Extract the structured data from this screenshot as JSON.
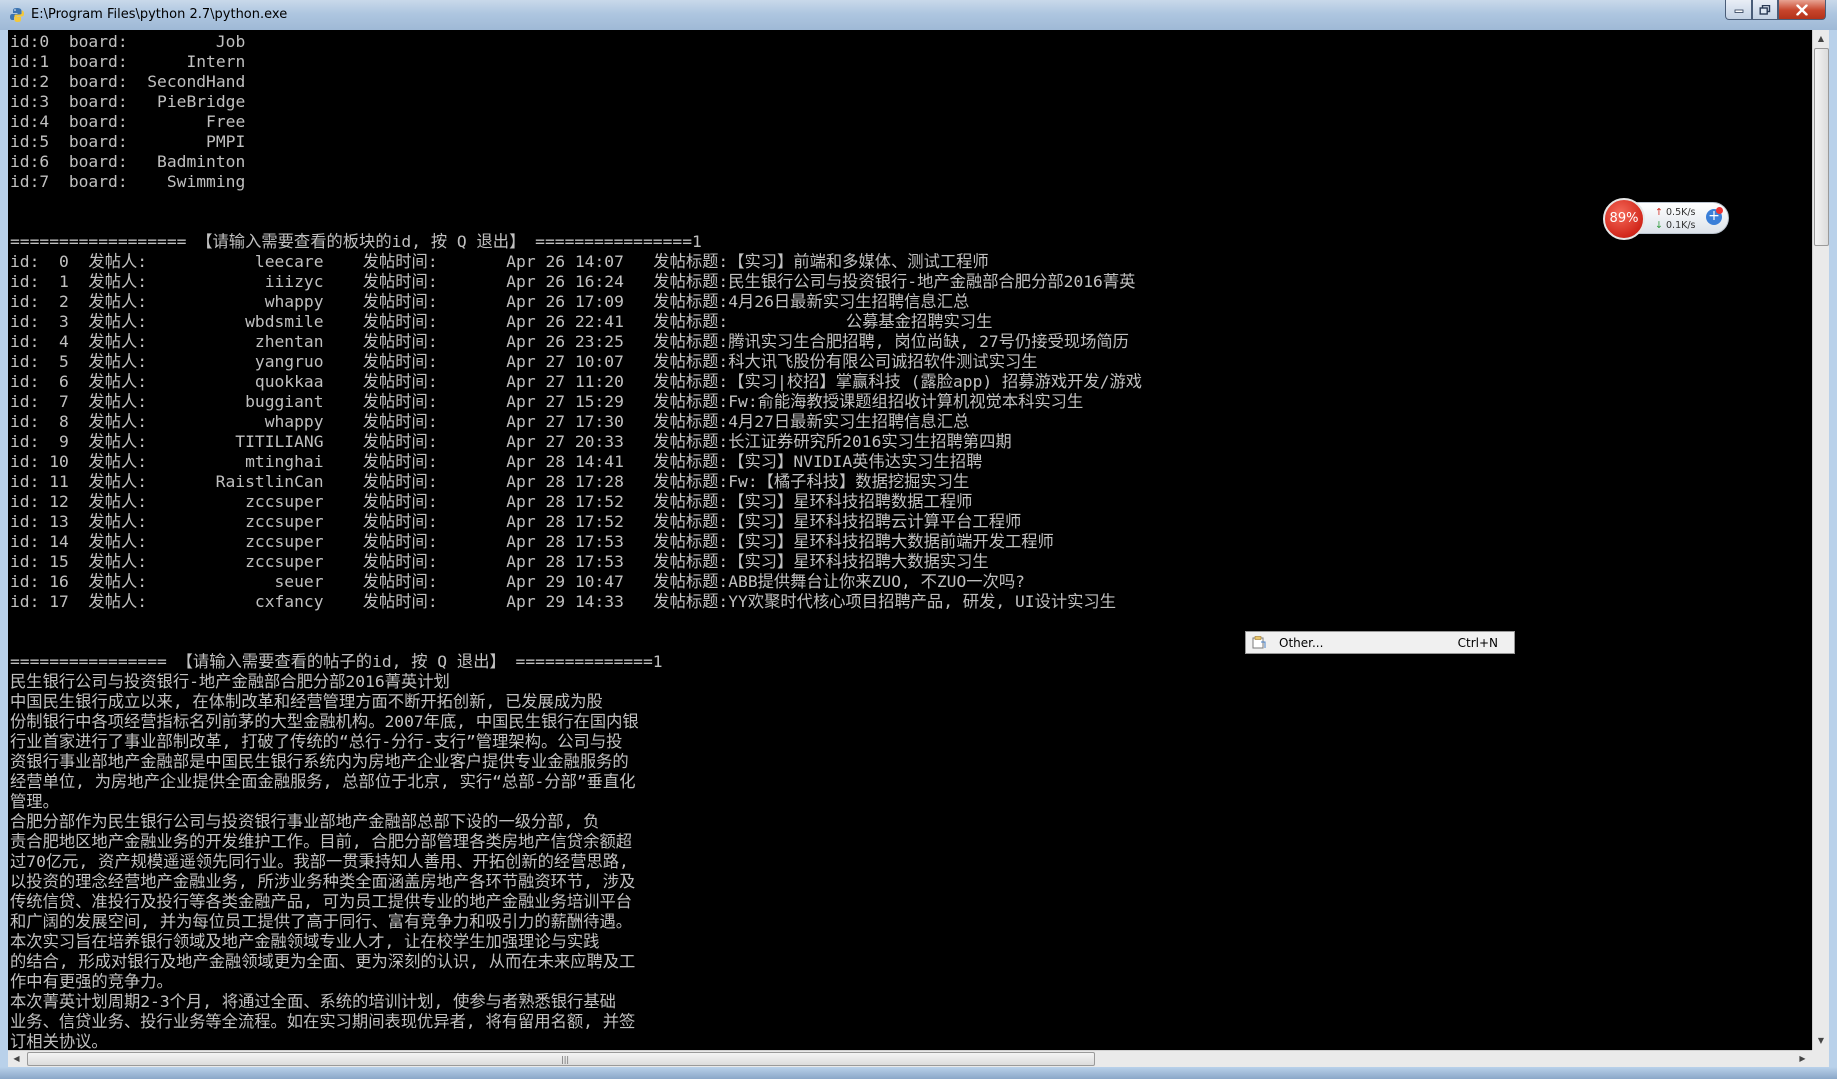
{
  "window": {
    "title": "E:\\Program Files\\python 2.7\\python.exe",
    "icon": "python-icon",
    "controls": [
      "minimize-icon",
      "maximize-icon",
      "close-icon"
    ]
  },
  "console": {
    "lines": [
      "id:0  board:         Job",
      "id:1  board:      Intern",
      "id:2  board:  SecondHand",
      "id:3  board:   PieBridge",
      "id:4  board:        Free",
      "id:5  board:        PMPI",
      "id:6  board:   Badminton",
      "id:7  board:    Swimming",
      "",
      "",
      "================== 【请输入需要查看的板块的id, 按 Q 退出】 ================1",
      "id:  0  发帖人:           leecare    发帖时间:       Apr 26 14:07   发帖标题:【实习】前端和多媒体、测试工程师",
      "id:  1  发帖人:            iiizyc    发帖时间:       Apr 26 16:24   发帖标题:民生银行公司与投资银行-地产金融部合肥分部2016菁英",
      "id:  2  发帖人:            whappy    发帖时间:       Apr 26 17:09   发帖标题:4月26日最新实习生招聘信息汇总",
      "id:  3  发帖人:          wbdsmile    发帖时间:       Apr 26 22:41   发帖标题:            公募基金招聘实习生",
      "id:  4  发帖人:           zhentan    发帖时间:       Apr 26 23:25   发帖标题:腾讯实习生合肥招聘, 岗位尚缺, 27号仍接受现场简历",
      "id:  5  发帖人:           yangruo    发帖时间:       Apr 27 10:07   发帖标题:科大讯飞股份有限公司诚招软件测试实习生",
      "id:  6  发帖人:           quokkaa    发帖时间:       Apr 27 11:20   发帖标题:【实习|校招】掌赢科技 (露脸app) 招募游戏开发/游戏",
      "id:  7  发帖人:          buggiant    发帖时间:       Apr 27 15:29   发帖标题:Fw:俞能海教授课题组招收计算机视觉本科实习生",
      "id:  8  发帖人:            whappy    发帖时间:       Apr 27 17:30   发帖标题:4月27日最新实习生招聘信息汇总",
      "id:  9  发帖人:         TITILIANG    发帖时间:       Apr 27 20:33   发帖标题:长江证券研究所2016实习生招聘第四期",
      "id: 10  发帖人:          mtinghai    发帖时间:       Apr 28 14:41   发帖标题:【实习】NVIDIA英伟达实习生招聘",
      "id: 11  发帖人:       RaistlinCan    发帖时间:       Apr 28 17:28   发帖标题:Fw:【橘子科技】数据挖掘实习生",
      "id: 12  发帖人:          zccsuper    发帖时间:       Apr 28 17:52   发帖标题:【实习】星环科技招聘数据工程师",
      "id: 13  发帖人:          zccsuper    发帖时间:       Apr 28 17:52   发帖标题:【实习】星环科技招聘云计算平台工程师",
      "id: 14  发帖人:          zccsuper    发帖时间:       Apr 28 17:53   发帖标题:【实习】星环科技招聘大数据前端开发工程师",
      "id: 15  发帖人:          zccsuper    发帖时间:       Apr 28 17:53   发帖标题:【实习】星环科技招聘大数据实习生",
      "id: 16  发帖人:             seuer    发帖时间:       Apr 29 10:47   发帖标题:ABB提供舞台让你来ZUO, 不ZUO一次吗?",
      "id: 17  发帖人:           cxfancy    发帖时间:       Apr 29 14:33   发帖标题:YY欢聚时代核心项目招聘产品, 研发, UI设计实习生",
      "",
      "",
      "================ 【请输入需要查看的帖子的id, 按 Q 退出】 ==============1",
      "民生银行公司与投资银行-地产金融部合肥分部2016菁英计划",
      "中国民生银行成立以来, 在体制改革和经营管理方面不断开拓创新, 已发展成为股",
      "份制银行中各项经营指标名列前茅的大型金融机构。2007年底, 中国民生银行在国内银",
      "行业首家进行了事业部制改革, 打破了传统的“总行-分行-支行”管理架构。公司与投",
      "资银行事业部地产金融部是中国民生银行系统内为房地产企业客户提供专业金融服务的",
      "经营单位, 为房地产企业提供全面金融服务, 总部位于北京, 实行“总部-分部”垂直化",
      "管理。",
      "合肥分部作为民生银行公司与投资银行事业部地产金融部总部下设的一级分部, 负",
      "责合肥地区地产金融业务的开发维护工作。目前, 合肥分部管理各类房地产信贷余额超",
      "过70亿元, 资产规模遥遥领先同行业。我部一贯秉持知人善用、开拓创新的经营思路,",
      "以投资的理念经营地产金融业务, 所涉业务种类全面涵盖房地产各环节融资环节, 涉及",
      "传统信贷、准投行及投行等各类金融产品, 可为员工提供专业的地产金融业务培训平台",
      "和广阔的发展空间, 并为每位员工提供了高于同行、富有竞争力和吸引力的薪酬待遇。",
      "本次实习旨在培养银行领域及地产金融领域专业人才, 让在校学生加强理论与实践",
      "的结合, 形成对银行及地产金融领域更为全面、更为深刻的认识, 从而在未来应聘及工",
      "作中有更强的竞争力。",
      "本次菁英计划周期2-3个月, 将通过全面、系统的培训计划, 使参与者熟悉银行基础",
      "业务、信贷业务、投行业务等全流程。如在实习期间表现优异者, 将有留用名额, 并签",
      "订相关协议。"
    ]
  },
  "context_menu": {
    "icon": "menu-item-icon",
    "label": "Other...",
    "shortcut": "Ctrl+N"
  },
  "net_widget": {
    "percent": "89%",
    "upload": "0.5K/s",
    "download": "0.1K/s",
    "accent": "#d2271b"
  }
}
